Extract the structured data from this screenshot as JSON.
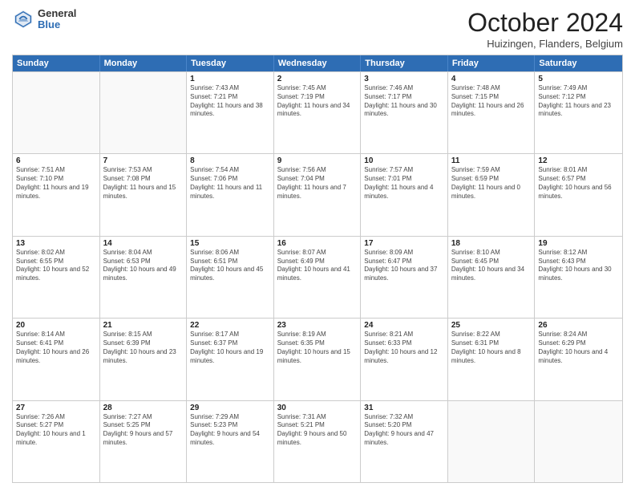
{
  "logo": {
    "general": "General",
    "blue": "Blue"
  },
  "header": {
    "month": "October 2024",
    "location": "Huizingen, Flanders, Belgium"
  },
  "days": [
    "Sunday",
    "Monday",
    "Tuesday",
    "Wednesday",
    "Thursday",
    "Friday",
    "Saturday"
  ],
  "weeks": [
    [
      {
        "day": "",
        "text": ""
      },
      {
        "day": "",
        "text": ""
      },
      {
        "day": "1",
        "text": "Sunrise: 7:43 AM\nSunset: 7:21 PM\nDaylight: 11 hours and 38 minutes."
      },
      {
        "day": "2",
        "text": "Sunrise: 7:45 AM\nSunset: 7:19 PM\nDaylight: 11 hours and 34 minutes."
      },
      {
        "day": "3",
        "text": "Sunrise: 7:46 AM\nSunset: 7:17 PM\nDaylight: 11 hours and 30 minutes."
      },
      {
        "day": "4",
        "text": "Sunrise: 7:48 AM\nSunset: 7:15 PM\nDaylight: 11 hours and 26 minutes."
      },
      {
        "day": "5",
        "text": "Sunrise: 7:49 AM\nSunset: 7:12 PM\nDaylight: 11 hours and 23 minutes."
      }
    ],
    [
      {
        "day": "6",
        "text": "Sunrise: 7:51 AM\nSunset: 7:10 PM\nDaylight: 11 hours and 19 minutes."
      },
      {
        "day": "7",
        "text": "Sunrise: 7:53 AM\nSunset: 7:08 PM\nDaylight: 11 hours and 15 minutes."
      },
      {
        "day": "8",
        "text": "Sunrise: 7:54 AM\nSunset: 7:06 PM\nDaylight: 11 hours and 11 minutes."
      },
      {
        "day": "9",
        "text": "Sunrise: 7:56 AM\nSunset: 7:04 PM\nDaylight: 11 hours and 7 minutes."
      },
      {
        "day": "10",
        "text": "Sunrise: 7:57 AM\nSunset: 7:01 PM\nDaylight: 11 hours and 4 minutes."
      },
      {
        "day": "11",
        "text": "Sunrise: 7:59 AM\nSunset: 6:59 PM\nDaylight: 11 hours and 0 minutes."
      },
      {
        "day": "12",
        "text": "Sunrise: 8:01 AM\nSunset: 6:57 PM\nDaylight: 10 hours and 56 minutes."
      }
    ],
    [
      {
        "day": "13",
        "text": "Sunrise: 8:02 AM\nSunset: 6:55 PM\nDaylight: 10 hours and 52 minutes."
      },
      {
        "day": "14",
        "text": "Sunrise: 8:04 AM\nSunset: 6:53 PM\nDaylight: 10 hours and 49 minutes."
      },
      {
        "day": "15",
        "text": "Sunrise: 8:06 AM\nSunset: 6:51 PM\nDaylight: 10 hours and 45 minutes."
      },
      {
        "day": "16",
        "text": "Sunrise: 8:07 AM\nSunset: 6:49 PM\nDaylight: 10 hours and 41 minutes."
      },
      {
        "day": "17",
        "text": "Sunrise: 8:09 AM\nSunset: 6:47 PM\nDaylight: 10 hours and 37 minutes."
      },
      {
        "day": "18",
        "text": "Sunrise: 8:10 AM\nSunset: 6:45 PM\nDaylight: 10 hours and 34 minutes."
      },
      {
        "day": "19",
        "text": "Sunrise: 8:12 AM\nSunset: 6:43 PM\nDaylight: 10 hours and 30 minutes."
      }
    ],
    [
      {
        "day": "20",
        "text": "Sunrise: 8:14 AM\nSunset: 6:41 PM\nDaylight: 10 hours and 26 minutes."
      },
      {
        "day": "21",
        "text": "Sunrise: 8:15 AM\nSunset: 6:39 PM\nDaylight: 10 hours and 23 minutes."
      },
      {
        "day": "22",
        "text": "Sunrise: 8:17 AM\nSunset: 6:37 PM\nDaylight: 10 hours and 19 minutes."
      },
      {
        "day": "23",
        "text": "Sunrise: 8:19 AM\nSunset: 6:35 PM\nDaylight: 10 hours and 15 minutes."
      },
      {
        "day": "24",
        "text": "Sunrise: 8:21 AM\nSunset: 6:33 PM\nDaylight: 10 hours and 12 minutes."
      },
      {
        "day": "25",
        "text": "Sunrise: 8:22 AM\nSunset: 6:31 PM\nDaylight: 10 hours and 8 minutes."
      },
      {
        "day": "26",
        "text": "Sunrise: 8:24 AM\nSunset: 6:29 PM\nDaylight: 10 hours and 4 minutes."
      }
    ],
    [
      {
        "day": "27",
        "text": "Sunrise: 7:26 AM\nSunset: 5:27 PM\nDaylight: 10 hours and 1 minute."
      },
      {
        "day": "28",
        "text": "Sunrise: 7:27 AM\nSunset: 5:25 PM\nDaylight: 9 hours and 57 minutes."
      },
      {
        "day": "29",
        "text": "Sunrise: 7:29 AM\nSunset: 5:23 PM\nDaylight: 9 hours and 54 minutes."
      },
      {
        "day": "30",
        "text": "Sunrise: 7:31 AM\nSunset: 5:21 PM\nDaylight: 9 hours and 50 minutes."
      },
      {
        "day": "31",
        "text": "Sunrise: 7:32 AM\nSunset: 5:20 PM\nDaylight: 9 hours and 47 minutes."
      },
      {
        "day": "",
        "text": ""
      },
      {
        "day": "",
        "text": ""
      }
    ]
  ]
}
